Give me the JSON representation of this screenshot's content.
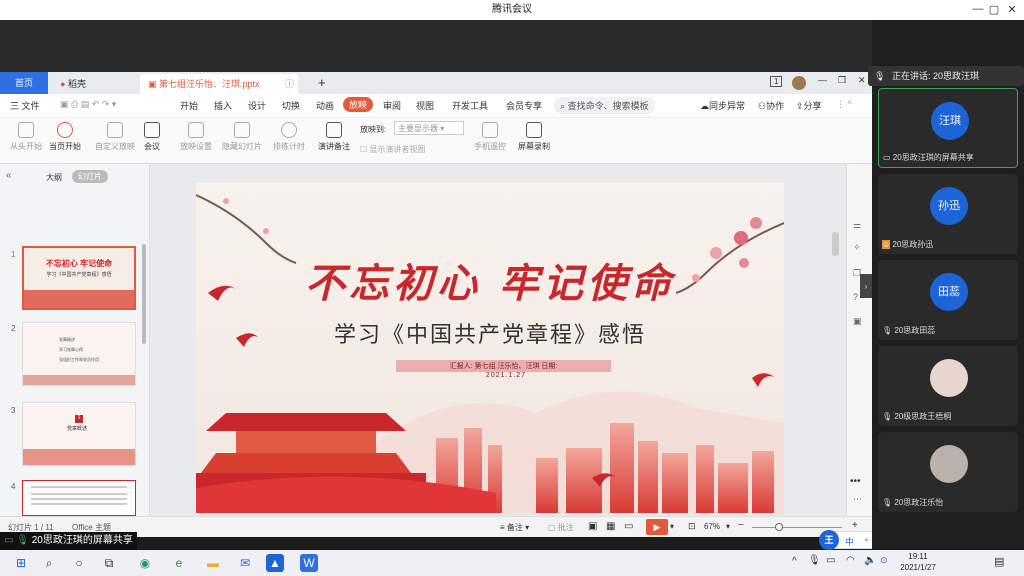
{
  "meeting": {
    "title": "腾讯会议",
    "controls": [
      "—",
      "▢",
      "✕"
    ]
  },
  "wps": {
    "tabs": [
      {
        "label": "首页"
      },
      {
        "label": "稻壳"
      },
      {
        "label": "第七组汪乐怡、汪琪.pptx"
      }
    ],
    "page_num_badge": "1",
    "menu": {
      "file": "三 文件",
      "items": [
        "开始",
        "插入",
        "设计",
        "切换",
        "动画",
        "放映",
        "审阅",
        "视图",
        "开发工具",
        "会员专享"
      ],
      "search": "查找命令、搜索模板",
      "right": [
        "同步异常",
        "协作",
        "分享"
      ]
    },
    "ribbon": {
      "buttons": [
        "从头开始",
        "当页开始",
        "自定义放映",
        "会议",
        "放映设置",
        "隐藏幻灯片",
        "排练计时",
        "演讲备注"
      ],
      "play_to_label": "放映到:",
      "play_to_value": "主要显示器",
      "presenter_view": "显示演讲者视图",
      "right_buttons": [
        "手机遥控",
        "屏幕录制"
      ]
    },
    "sidebar": {
      "tabs": [
        "大纲",
        "幻灯片"
      ],
      "slide_numbers": [
        "1",
        "2",
        "3",
        "4"
      ],
      "thumb1": {
        "title": "不忘初心 牢记使命",
        "sub": "学习《中国共产党章程》感悟"
      },
      "thumb2": {
        "items": [
          "党章概述",
          "学习党章心得",
          "党组织工作和党员作用"
        ]
      },
      "thumb3": {
        "num": "1",
        "title": "党章概述"
      }
    },
    "slide": {
      "title": "不忘初心 牢记使命",
      "subtitle": "学习《中国共产党章程》感悟",
      "reporter": "汇报人: 第七组 汪乐怡、汪琪      日期:",
      "date": "2021.1.27"
    },
    "status": {
      "slide_count": "幻灯片 1 / 11",
      "theme": "Office 主题",
      "notes": "备注",
      "comment": "批注",
      "zoom": "67%"
    }
  },
  "panel": {
    "speaking": "正在讲话: 20思政汪琪",
    "participants": [
      {
        "avatar": "汪琪",
        "label": "20思政汪琪的屏幕共享"
      },
      {
        "avatar": "孙迅",
        "label": "20思政孙迅"
      },
      {
        "avatar": "田蕊",
        "label": "20思政田蕊"
      },
      {
        "avatar": "",
        "label": "20级思政王梧桐"
      },
      {
        "avatar": "",
        "label": "20思政汪乐怡"
      }
    ],
    "more": "•••"
  },
  "share_label": "20思政汪琪的屏幕共享",
  "ime": {
    "avatar": "王",
    "items": [
      "中",
      "°,",
      "☺",
      "🎤",
      "⌨",
      "👔",
      "⚙"
    ]
  },
  "taskbar": {
    "time": "19:11",
    "date": "2021/1/27"
  },
  "colors": {
    "accent_red": "#c8282c",
    "wps_orange": "#e25a3b",
    "tencent_blue": "#1c64d8"
  }
}
